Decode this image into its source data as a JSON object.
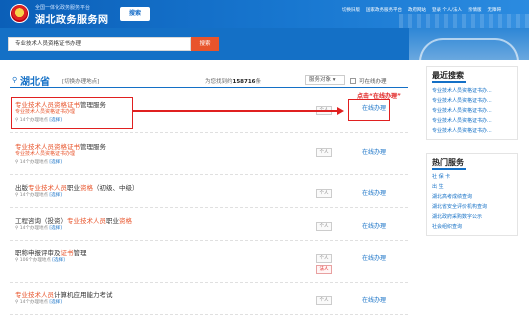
{
  "header": {
    "logo_subtitle": "全国一体化政务服务平台",
    "site_name": "湖北政务服务网",
    "search_button": "搜索",
    "top_links": [
      "切换旧版",
      "国家政务服务平台",
      "政府网站",
      "登录 个人/法人",
      "亲情版",
      "无障碍"
    ]
  },
  "search": {
    "query": "专业技术人员资格证书办理",
    "button": "搜索"
  },
  "filter": {
    "province": "湖北省",
    "switch_location": "[切换办理地点]",
    "result_prefix": "为您找到约",
    "result_count": "158716",
    "result_suffix": "条",
    "service_object": "服务对象",
    "online_only": "可在线办理"
  },
  "annotation": "点击“在线办理”",
  "results": [
    {
      "title_parts": [
        [
          "专业技术人员资格证书",
          true
        ],
        [
          "管理服务",
          false
        ]
      ],
      "sub": "专业技术人员资格证书办理",
      "meta_count": "14个办理地点",
      "meta_link": "[选择]",
      "badges": [
        "个人"
      ],
      "action": "在线办理"
    },
    {
      "title_parts": [
        [
          "专业技术人员资格证书",
          true
        ],
        [
          "管理服务",
          false
        ]
      ],
      "sub": "专业技术人员资格证书办理",
      "meta_count": "14个办理地点",
      "meta_link": "[选择]",
      "badges": [
        "个人"
      ],
      "action": "在线办理"
    },
    {
      "title_parts": [
        [
          "出版",
          false
        ],
        [
          "专业技术人员",
          true
        ],
        [
          "职业",
          false
        ],
        [
          "资格",
          true
        ],
        [
          "（初级、中级）",
          false
        ]
      ],
      "sub": "",
      "meta_count": "14个办理地点",
      "meta_link": "[选择]",
      "badges": [
        "个人"
      ],
      "action": "在线办理"
    },
    {
      "title_parts": [
        [
          "工程咨询（投资）",
          false
        ],
        [
          "专业技术人员",
          true
        ],
        [
          "职业",
          false
        ],
        [
          "资格",
          true
        ]
      ],
      "sub": "",
      "meta_count": "14个办理地点",
      "meta_link": "[选择]",
      "badges": [
        "个人"
      ],
      "action": "在线办理"
    },
    {
      "title_parts": [
        [
          "职称申报评审及",
          false
        ],
        [
          "证书",
          true
        ],
        [
          "管理",
          false
        ]
      ],
      "sub": "",
      "meta_count": "106个办理地点",
      "meta_link": "[选择]",
      "badges": [
        "个人",
        "法人"
      ],
      "action": "在线办理"
    },
    {
      "title_parts": [
        [
          "专业技术人员",
          true
        ],
        [
          "计算机应用能力考试",
          false
        ]
      ],
      "sub": "",
      "meta_count": "14个办理地点",
      "meta_link": "[选择]",
      "badges": [
        "个人"
      ],
      "action": "在线办理"
    }
  ],
  "sidebar": {
    "recent_title": "最近搜索",
    "recent_items": [
      "专业技术人员资格证书办...",
      "专业技术人员资格证书办...",
      "专业技术人员资格证书办...",
      "专业技术人员资格证书办...",
      "专业技术人员资格证书办..."
    ],
    "hot_title": "热门服务",
    "hot_items": [
      "社 保 卡",
      "出 生",
      "湖北高考成绩查询",
      "湖北省安全评价机构查询",
      "湖北政府采购数字公示",
      "社会组织查询"
    ]
  },
  "colors": {
    "brand_blue": "#1470c6",
    "highlight_orange": "#e8542b",
    "annotation_red": "#e02020"
  }
}
